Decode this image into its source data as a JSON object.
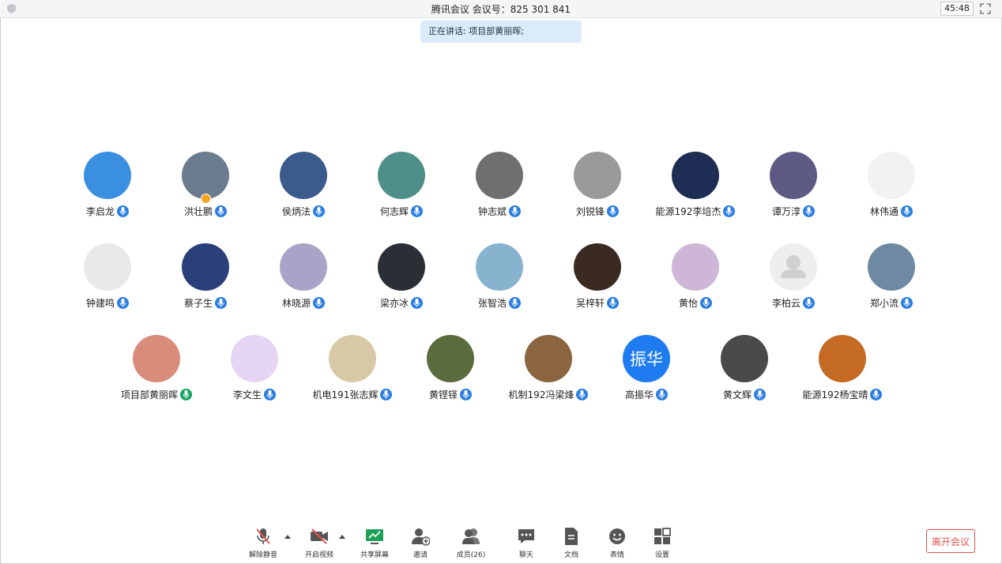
{
  "window": {
    "title": "腾讯会议 会议号：825 301 841",
    "timer": "45:48"
  },
  "speaking_banner": "正在讲话: 项目部黄丽晖;",
  "participants": [
    {
      "name": "李启龙",
      "mic": "blue",
      "avatar_color": "#3b8fe0",
      "avatar_icon": "cartoon-boy-avatar"
    },
    {
      "name": "洪壮鹏",
      "mic": "blue",
      "avatar_color": "#6b7c8e",
      "avatar_icon": "photo-avatar",
      "host": true
    },
    {
      "name": "侯炳法",
      "mic": "blue",
      "avatar_color": "#3b5b8c",
      "avatar_icon": "cartoon-mouse-avatar"
    },
    {
      "name": "何志辉",
      "mic": "blue",
      "avatar_color": "#4e8f8a",
      "avatar_icon": "photo-avatar"
    },
    {
      "name": "钟志斌",
      "mic": "blue",
      "avatar_color": "#6f6f6f",
      "avatar_icon": "photo-avatar"
    },
    {
      "name": "刘锐锋",
      "mic": "blue",
      "avatar_color": "#9a9a9a",
      "avatar_icon": "cat-avatar"
    },
    {
      "name": "能源192李培杰",
      "mic": "blue",
      "avatar_color": "#1d2d54",
      "avatar_icon": "photo-avatar"
    },
    {
      "name": "谭万淳",
      "mic": "blue",
      "avatar_color": "#5d5a84",
      "avatar_icon": "cartoon-bear-avatar"
    },
    {
      "name": "林伟通",
      "mic": "blue",
      "avatar_color": "#f2f2f2",
      "avatar_icon": "signature-avatar"
    },
    {
      "name": "钟建鸣",
      "mic": "blue",
      "avatar_color": "#e9e9e9",
      "avatar_icon": "meme-avatar"
    },
    {
      "name": "蔡子生",
      "mic": "blue",
      "avatar_color": "#2b3f7a",
      "avatar_icon": "night-sky-avatar"
    },
    {
      "name": "林晓源",
      "mic": "blue",
      "avatar_color": "#a9a3c8",
      "avatar_icon": "anime-girl-avatar"
    },
    {
      "name": "梁亦冰",
      "mic": "blue",
      "avatar_color": "#2a2f36",
      "avatar_icon": "photo-avatar"
    },
    {
      "name": "张智浩",
      "mic": "blue",
      "avatar_color": "#87b3cf",
      "avatar_icon": "cat-avatar"
    },
    {
      "name": "吴梓轩",
      "mic": "blue",
      "avatar_color": "#3a2a22",
      "avatar_icon": "photo-avatar"
    },
    {
      "name": "黄怡",
      "mic": "blue",
      "avatar_color": "#cdb6d6",
      "avatar_icon": "anime-girl-avatar"
    },
    {
      "name": "李柏云",
      "mic": "blue",
      "avatar_color": "#eeeeee",
      "avatar_icon": "default-user-avatar"
    },
    {
      "name": "郑小流",
      "mic": "blue",
      "avatar_color": "#6e8aa3",
      "avatar_icon": "landscape-avatar"
    },
    {
      "name": "项目部黄丽晖",
      "mic": "green",
      "avatar_color": "#d98c7a",
      "avatar_icon": "cartoon-cat-avatar"
    },
    {
      "name": "李文生",
      "mic": "blue",
      "avatar_color": "#e6d4f3",
      "avatar_icon": "cartoon-avatar"
    },
    {
      "name": "机电191张志辉",
      "mic": "blue",
      "avatar_color": "#d8c8a6",
      "avatar_icon": "anime-boy-avatar"
    },
    {
      "name": "黄铿铎",
      "mic": "blue",
      "avatar_color": "#5a6b3e",
      "avatar_icon": "anime-avatar"
    },
    {
      "name": "机制192冯梁烽",
      "mic": "blue",
      "avatar_color": "#8a6540",
      "avatar_icon": "succulent-avatar"
    },
    {
      "name": "高振华",
      "mic": "blue",
      "avatar_color": "#1f7cf0",
      "avatar_icon": "initials-avatar",
      "initials": "振华"
    },
    {
      "name": "黄文辉",
      "mic": "blue",
      "avatar_color": "#4a4a4a",
      "avatar_icon": "photo-avatar"
    },
    {
      "name": "能源192杨宝晴",
      "mic": "blue",
      "avatar_color": "#c46a22",
      "avatar_icon": "photo-avatar"
    }
  ],
  "toolbar": {
    "unmute": "解除静音",
    "start_video": "开启视频",
    "share_screen": "共享屏幕",
    "invite": "邀请",
    "members": "成员(26)",
    "chat": "聊天",
    "docs": "文档",
    "reactions": "表情",
    "settings": "设置",
    "leave": "离开会议"
  },
  "colors": {
    "accent_blue": "#2a7de1",
    "talking_green": "#14a35c",
    "leave_red": "#e4544f",
    "share_green": "#1ea05a"
  }
}
